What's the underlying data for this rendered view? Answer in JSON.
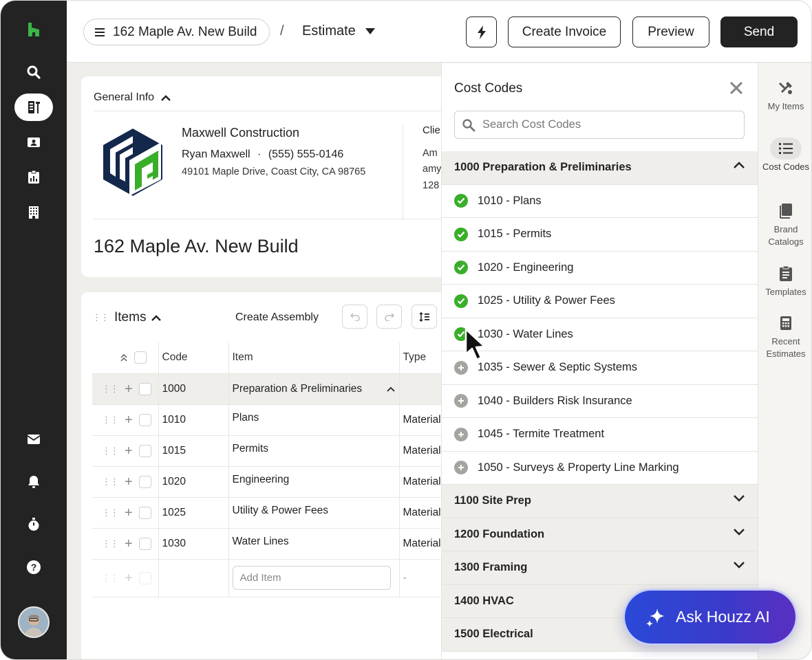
{
  "topbar": {
    "project_label": "162 Maple Av. New Build",
    "separator": "/",
    "view_label": "Estimate",
    "create_invoice": "Create Invoice",
    "preview": "Preview",
    "send": "Send"
  },
  "nav": {
    "icons": [
      "houzz-logo-icon",
      "search-icon",
      "projects-icon",
      "contacts-icon",
      "reports-icon",
      "company-icon",
      "inbox-icon",
      "bell-icon",
      "timer-icon",
      "help-icon"
    ]
  },
  "general_info": {
    "heading": "General Info",
    "company": "Maxwell Construction",
    "contact_name": "Ryan Maxwell",
    "contact_sep": "·",
    "phone": "(555) 555-0146",
    "address": "49101 Maple Drive, Coast City, CA 98765",
    "client_label": "Clie",
    "client_lines": [
      "Am",
      "amy",
      "128"
    ],
    "project_title": "162 Maple Av. New Build"
  },
  "items": {
    "heading": "Items",
    "create_assembly": "Create Assembly",
    "columns": [
      "Code",
      "Item",
      "Type"
    ],
    "group": {
      "code": "1000",
      "name": "Preparation & Preliminaries"
    },
    "rows": [
      {
        "code": "1010",
        "item": "Plans",
        "type": "Material"
      },
      {
        "code": "1015",
        "item": "Permits",
        "type": "Material"
      },
      {
        "code": "1020",
        "item": "Engineering",
        "type": "Material"
      },
      {
        "code": "1025",
        "item": "Utility & Power Fees",
        "type": "Material"
      },
      {
        "code": "1030",
        "item": "Water Lines",
        "type": "Material"
      }
    ],
    "add_placeholder": "Add Item",
    "empty_type": "-"
  },
  "cost_codes": {
    "title": "Cost Codes",
    "search_placeholder": "Search Cost Codes",
    "expanded_group": "1000 Preparation & Preliminaries",
    "codes": [
      {
        "label": "1010 - Plans",
        "state": "added"
      },
      {
        "label": "1015 - Permits",
        "state": "added"
      },
      {
        "label": "1020 - Engineering",
        "state": "added"
      },
      {
        "label": "1025 - Utility & Power Fees",
        "state": "added"
      },
      {
        "label": "1030 - Water Lines",
        "state": "added"
      },
      {
        "label": "1035 - Sewer & Septic Systems",
        "state": "available"
      },
      {
        "label": "1040 - Builders Risk Insurance",
        "state": "available"
      },
      {
        "label": "1045 - Termite Treatment",
        "state": "available"
      },
      {
        "label": "1050 - Surveys & Property Line Marking",
        "state": "available"
      }
    ],
    "collapsed_groups": [
      "1100 Site Prep",
      "1200 Foundation",
      "1300 Framing",
      "1400 HVAC",
      "1500 Electrical"
    ]
  },
  "rail": {
    "items": [
      {
        "label": "My Items",
        "icon": "tools-icon"
      },
      {
        "label": "Cost Codes",
        "icon": "list-icon"
      },
      {
        "label": "Brand Catalogs",
        "icon": "book-icon"
      },
      {
        "label": "Templates",
        "icon": "clipboard-icon"
      },
      {
        "label": "Recent Estimates",
        "icon": "calculator-icon"
      }
    ]
  },
  "ask_ai": {
    "label": "Ask Houzz AI"
  },
  "colors": {
    "nav_bg": "#232323",
    "houzz_green": "#3bb547",
    "check_green": "#3aae2a",
    "ai_gradient_start": "#2a49d8",
    "ai_gradient_end": "#5a2fc2"
  }
}
